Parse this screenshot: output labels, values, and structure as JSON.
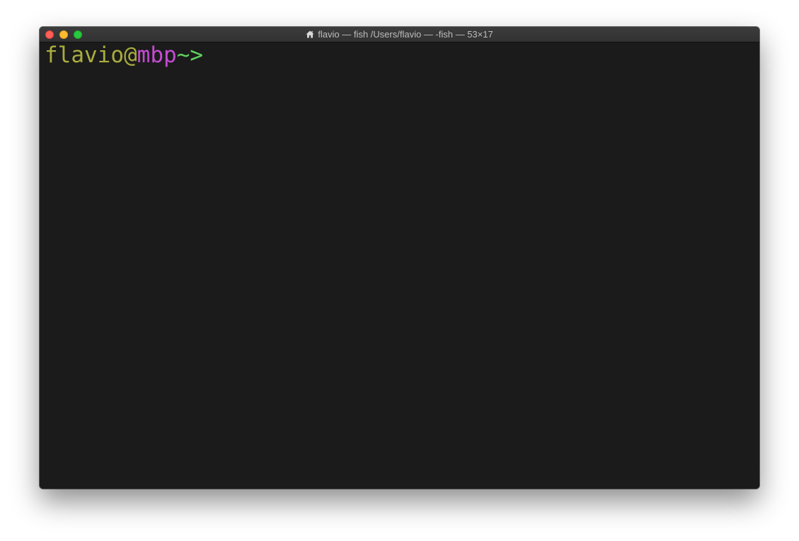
{
  "window": {
    "title": "flavio — fish /Users/flavio — -fish — 53×17",
    "title_icon": "home-icon"
  },
  "terminal": {
    "prompt": {
      "user": "flavio",
      "at": "@",
      "host": "mbp",
      "cwd": "~",
      "symbol": ">"
    }
  },
  "colors": {
    "background": "#1b1b1b",
    "user": "#aaad3e",
    "host": "#c54bd3",
    "cwd": "#5fd15f"
  }
}
